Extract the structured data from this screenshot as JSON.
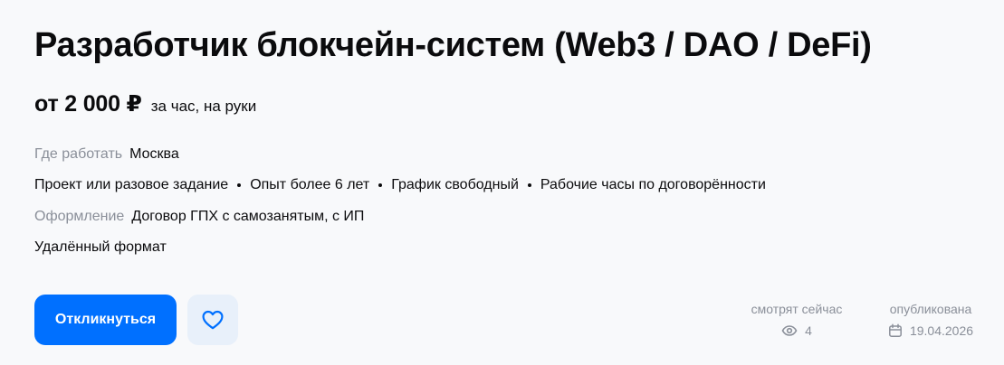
{
  "vacancy": {
    "title": "Разработчик блокчейн-систем (Web3 / DAO / DeFi)",
    "salary_amount": "от 2 000 ₽",
    "salary_note": "за час, на руки",
    "location_label": "Где работать",
    "location_value": "Москва",
    "tags": [
      "Проект или разовое задание",
      "Опыт более 6 лет",
      "График свободный",
      "Рабочие часы по договорённости"
    ],
    "contract_label": "Оформление",
    "contract_value": "Договор ГПХ с самозанятым, с ИП",
    "format": "Удалённый формат"
  },
  "actions": {
    "apply_label": "Откликнуться",
    "favorite_icon": "heart-icon"
  },
  "stats": {
    "watching_label": "смотрят сейчас",
    "watching_count": "4",
    "watching_icon": "eye-icon",
    "published_label": "опубликована",
    "published_date": "19.04.2026",
    "published_icon": "calendar-icon"
  },
  "colors": {
    "primary": "#0070ff",
    "favorite_bg": "#e8f0fa",
    "muted_text": "#8a8f99",
    "background": "#f8f9fb"
  }
}
